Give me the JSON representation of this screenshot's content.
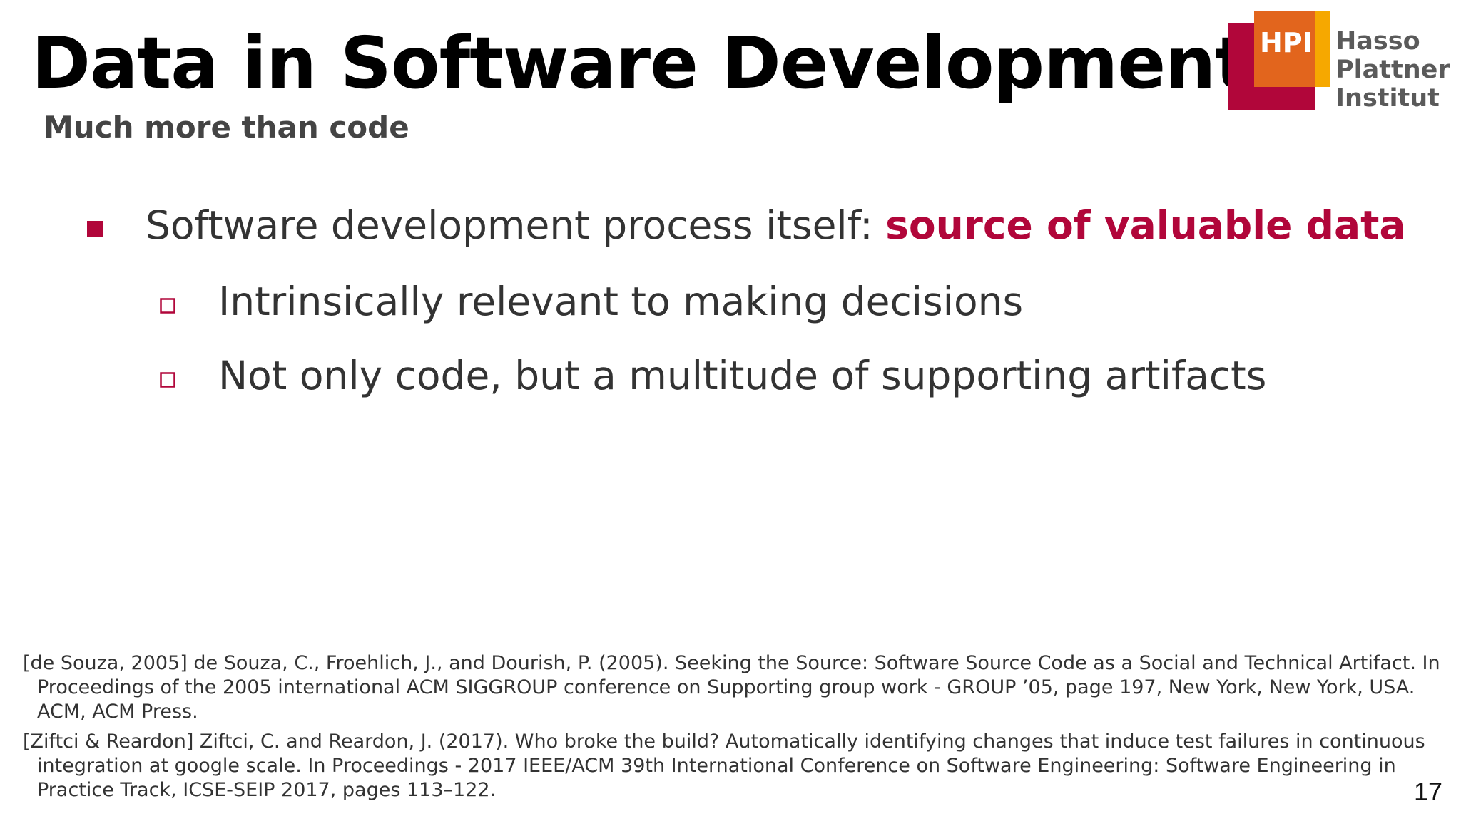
{
  "slide": {
    "title": "Data in Software Development",
    "subtitle": "Much more than code",
    "page_number": "17"
  },
  "logo": {
    "abbr": "HPI",
    "name_lines": [
      "Hasso",
      "Plattner",
      "Institut"
    ],
    "colors": {
      "red": "#b1063a",
      "orange": "#f6a800",
      "orange_inner": "#e2651d"
    }
  },
  "bullets": {
    "main": {
      "text": "Software development process itself: ",
      "highlight": "source of valuable data"
    },
    "sub": [
      "Intrinsically relevant to making decisions",
      "Not only code, but a multitude of supporting artifacts"
    ]
  },
  "references": [
    {
      "lines": [
        "[de Souza, 2005] de Souza, C., Froehlich, J., and Dourish, P. (2005). Seeking the Source: Software Source Code as a Social and Technical Artifact. In",
        "Proceedings of the 2005 international ACM SIGGROUP conference on Supporting group work - GROUP ’05, page 197, New York, New York, USA.",
        "ACM, ACM Press."
      ]
    },
    {
      "lines": [
        "[Ziftci & Reardon] Ziftci, C. and Reardon, J. (2017). Who broke the build? Automatically identifying changes that induce test failures in continuous",
        "integration at google scale. In Proceedings - 2017 IEEE/ACM 39th International Conference on Software Engineering: Software Engineering in",
        "Practice Track, ICSE-SEIP 2017, pages 113–122."
      ]
    }
  ],
  "theme": {
    "accent": "#b1063a",
    "text": "#333333",
    "title": "#000000"
  }
}
